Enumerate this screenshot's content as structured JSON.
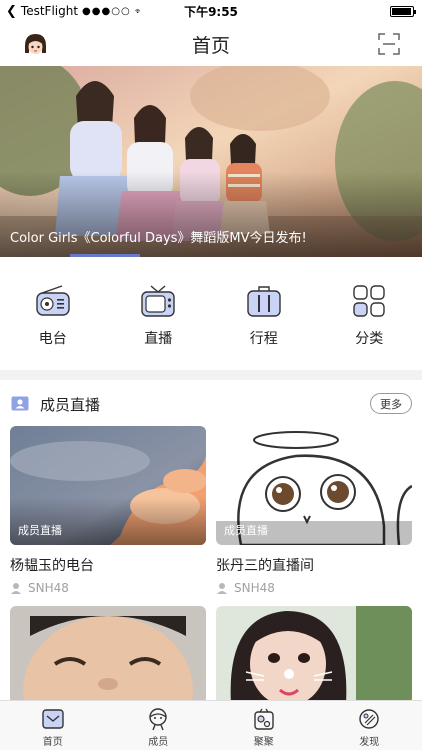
{
  "status_bar": {
    "back_app": "TestFlight",
    "signal_dots": "●●●○○",
    "time": "下午9:55",
    "battery_level": 0.95
  },
  "nav": {
    "title": "首页",
    "avatar_icon": "girl-avatar-icon",
    "scan_icon": "scan-icon"
  },
  "banner": {
    "caption": "Color Girls《Colorful Days》舞蹈版MV今日发布!"
  },
  "categories": [
    {
      "label": "电台",
      "icon": "radio-icon"
    },
    {
      "label": "直播",
      "icon": "tv-icon"
    },
    {
      "label": "行程",
      "icon": "luggage-icon"
    },
    {
      "label": "分类",
      "icon": "category-grid-icon"
    }
  ],
  "section": {
    "title": "成员直播",
    "more_label": "更多"
  },
  "cards": [
    {
      "tag": "成员直播",
      "title": "杨韫玉的电台",
      "group": "SNH48"
    },
    {
      "tag": "成员直播",
      "title": "张丹三的直播间",
      "group": "SNH48"
    }
  ],
  "tabs": [
    {
      "label": "首页",
      "icon": "home-mail-icon"
    },
    {
      "label": "成员",
      "icon": "member-icon"
    },
    {
      "label": "聚聚",
      "icon": "gather-icon"
    },
    {
      "label": "发现",
      "icon": "discover-icon"
    }
  ],
  "colors": {
    "accent": "#6a78c9",
    "icon_fill": "#c8d3f5"
  }
}
